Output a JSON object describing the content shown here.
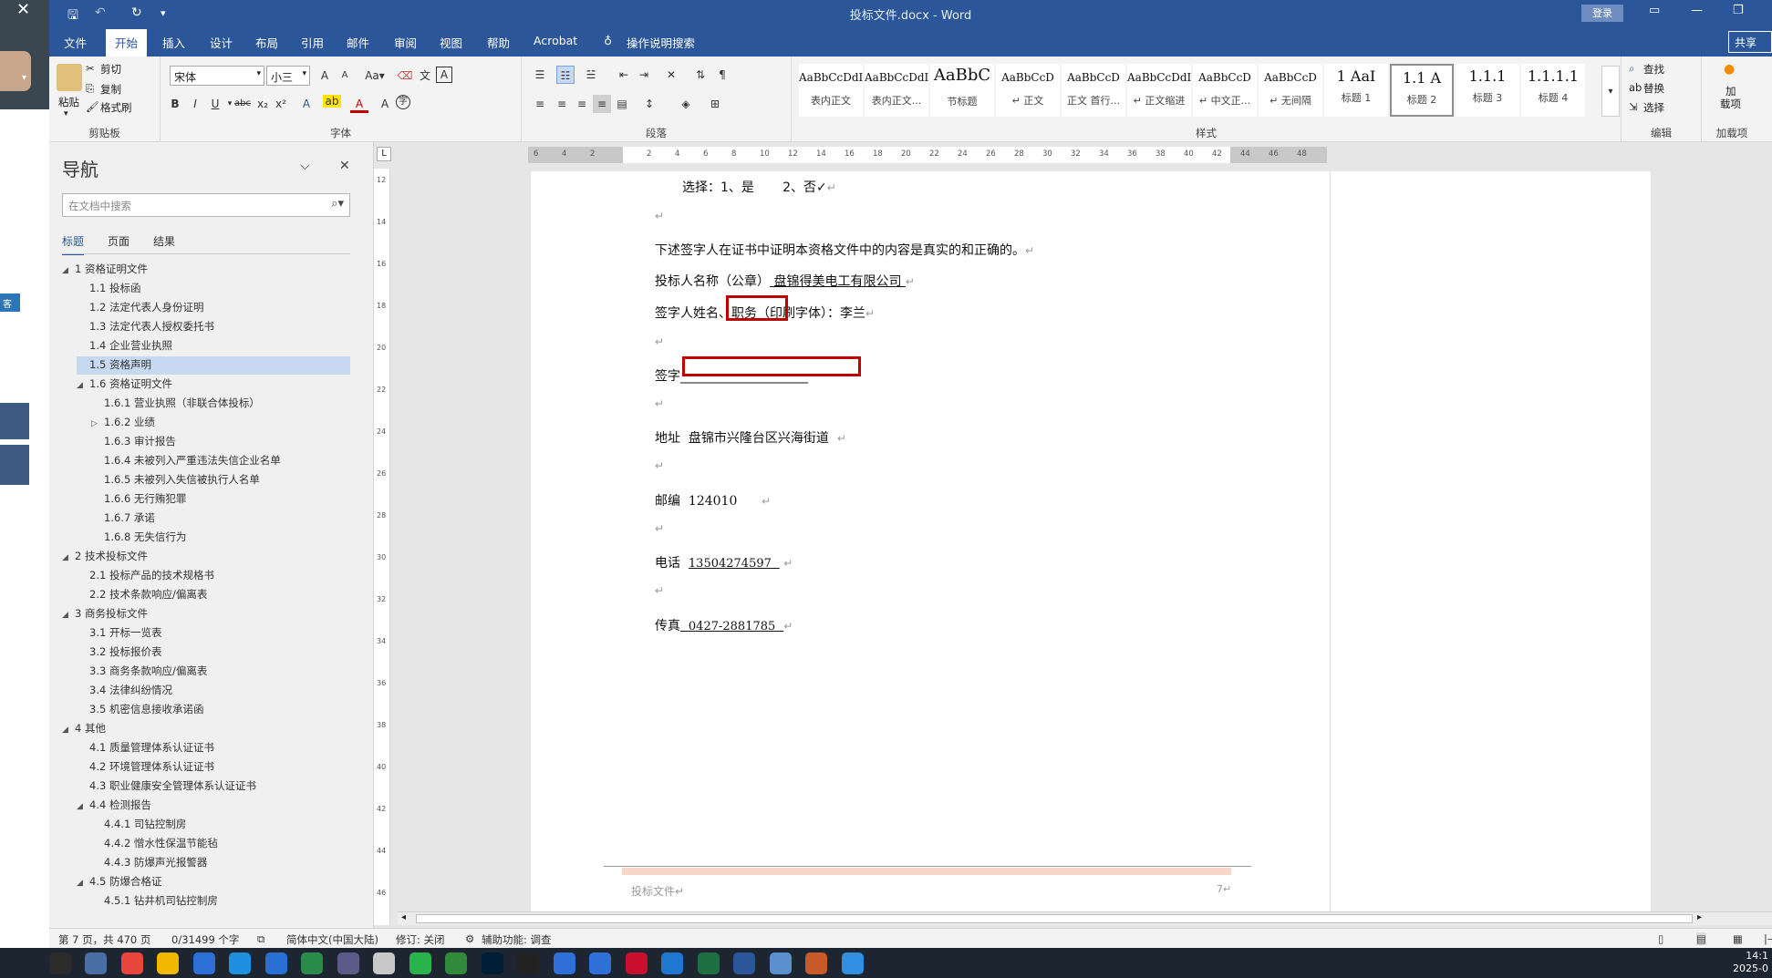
{
  "window": {
    "title": "投标文件.docx  -  Word",
    "login_label": "登录",
    "minimize_glyph": "—",
    "restore_glyph": "❐",
    "layout_glyph": "▭"
  },
  "quick_access": {
    "save_icon": "save-icon",
    "undo_icon": "undo-icon",
    "redo_icon": "redo-icon"
  },
  "tabs": [
    "文件",
    "开始",
    "插入",
    "设计",
    "布局",
    "引用",
    "邮件",
    "审阅",
    "视图",
    "帮助",
    "Acrobat",
    "操作说明搜索"
  ],
  "active_tab": "开始",
  "share_label": "共享",
  "ribbon": {
    "clipboard": {
      "paste": "粘贴",
      "cut": "剪切",
      "copy": "复制",
      "format_painter": "格式刷",
      "label": "剪贴板"
    },
    "font": {
      "name": "宋体",
      "size": "小三",
      "label": "字体",
      "aa": "Aa",
      "grow": "A",
      "shrink": "A"
    },
    "paragraph": {
      "label": "段落"
    },
    "styles": {
      "label": "样式",
      "items": [
        {
          "preview": "AaBbCcDdI",
          "name": "表内正文"
        },
        {
          "preview": "AaBbCcDdI",
          "name": "表内正文..."
        },
        {
          "preview": "AaBbC",
          "name": "节标题"
        },
        {
          "preview": "AaBbCcD",
          "name": "↵ 正文"
        },
        {
          "preview": "AaBbCcD",
          "name": "正文 首行..."
        },
        {
          "preview": "AaBbCcDdI",
          "name": "↵ 正文缩进"
        },
        {
          "preview": "AaBbCcD",
          "name": "↵ 中文正..."
        },
        {
          "preview": "AaBbCcD",
          "name": "↵ 无间隔"
        },
        {
          "preview": "1   AaI",
          "name": "标题 1"
        },
        {
          "preview": "1.1  A",
          "name": "标题 2"
        },
        {
          "preview": "1.1.1",
          "name": "标题 3"
        },
        {
          "preview": "1.1.1.1",
          "name": "标题 4"
        }
      ],
      "selected": "标题 2"
    },
    "editing": {
      "find": "查找",
      "replace": "替换",
      "select": "选择",
      "label": "编辑"
    },
    "addins": {
      "label_line1": "加",
      "label_line2": "载项",
      "group_label": "加载项"
    }
  },
  "nav": {
    "title": "导航",
    "search_placeholder": "在文档中搜索",
    "tabs": [
      "标题",
      "页面",
      "结果"
    ],
    "active_tab": "标题",
    "items": [
      {
        "text": "1 资格证明文件",
        "toggle": "◢"
      },
      {
        "text": "1.1 投标函",
        "toggle": ""
      },
      {
        "text": "1.2 法定代表人身份证明",
        "toggle": ""
      },
      {
        "text": "1.3 法定代表人授权委托书",
        "toggle": ""
      },
      {
        "text": "1.4 企业营业执照",
        "toggle": ""
      },
      {
        "text": "1.5 资格声明",
        "toggle": ""
      },
      {
        "text": "1.6 资格证明文件",
        "toggle": "◢"
      },
      {
        "text": "1.6.1 营业执照（非联合体投标）",
        "toggle": ""
      },
      {
        "text": "1.6.2 业绩",
        "toggle": "▷"
      },
      {
        "text": "1.6.3 审计报告",
        "toggle": ""
      },
      {
        "text": "1.6.4 未被列入严重违法失信企业名单",
        "toggle": ""
      },
      {
        "text": "1.6.5 未被列入失信被执行人名单",
        "toggle": ""
      },
      {
        "text": "1.6.6 无行贿犯罪",
        "toggle": ""
      },
      {
        "text": "1.6.7 承诺",
        "toggle": ""
      },
      {
        "text": "1.6.8 无失信行为",
        "toggle": ""
      },
      {
        "text": "2 技术投标文件",
        "toggle": "◢"
      },
      {
        "text": "2.1 投标产品的技术规格书",
        "toggle": ""
      },
      {
        "text": "2.2 技术条款响应/偏离表",
        "toggle": ""
      },
      {
        "text": "3 商务投标文件",
        "toggle": "◢"
      },
      {
        "text": "3.1 开标一览表",
        "toggle": ""
      },
      {
        "text": "3.2 投标报价表",
        "toggle": ""
      },
      {
        "text": "3.3 商务条款响应/偏离表",
        "toggle": ""
      },
      {
        "text": "3.4 法律纠纷情况",
        "toggle": ""
      },
      {
        "text": "3.5 机密信息接收承诺函",
        "toggle": ""
      },
      {
        "text": "4 其他",
        "toggle": "◢"
      },
      {
        "text": "4.1 质量管理体系认证证书",
        "toggle": ""
      },
      {
        "text": "4.2 环境管理体系认证证书",
        "toggle": ""
      },
      {
        "text": "4.3 职业健康安全管理体系认证证书",
        "toggle": ""
      },
      {
        "text": "4.4 检测报告",
        "toggle": "◢"
      },
      {
        "text": "4.4.1 司钻控制房",
        "toggle": ""
      },
      {
        "text": "4.4.2 憎水性保温节能毡",
        "toggle": ""
      },
      {
        "text": "4.4.3 防爆声光报警器",
        "toggle": ""
      },
      {
        "text": "4.5 防爆合格证",
        "toggle": "◢"
      },
      {
        "text": "4.5.1 钻井机司钻控制房",
        "toggle": ""
      }
    ],
    "selected": "1.5 资格声明"
  },
  "ruler": {
    "h_ticks": [
      "6",
      "4",
      "2",
      "",
      "2",
      "4",
      "6",
      "8",
      "10",
      "12",
      "14",
      "16",
      "18",
      "20",
      "22",
      "24",
      "26",
      "28",
      "30",
      "32",
      "34",
      "36",
      "38",
      "40",
      "42",
      "44",
      "46",
      "48"
    ],
    "v_ticks": [
      "12",
      "14",
      "16",
      "18",
      "20",
      "22",
      "24",
      "26",
      "28",
      "30",
      "32",
      "34",
      "36",
      "38",
      "40",
      "42",
      "44",
      "46"
    ]
  },
  "document": {
    "line_select": {
      "label": "选择：",
      "opt1": "1、是",
      "opt2": "2、否",
      "check": "✓"
    },
    "line_statement": "下述签字人在证书中证明本资格文件中的内容是真实的和正确的。",
    "line_bidder": {
      "label": "投标人名称（公章）",
      "value": "盘锦得美电工有限公司"
    },
    "line_signer": {
      "label1": "签字人姓名",
      "label2": "、职务",
      "label3": "（印刷字体）：",
      "value": "李兰"
    },
    "line_sign": {
      "label": "签字",
      "blank": "____________________"
    },
    "line_address": {
      "label": "地址",
      "value": "盘锦市兴隆台区兴海街道"
    },
    "line_postcode": {
      "label": "邮编",
      "value": "124010"
    },
    "line_phone": {
      "label": "电话",
      "value": "13504274597"
    },
    "line_fax": {
      "label": "传真",
      "value": "0427-2881785"
    },
    "para_mark": "↵",
    "footer_text": "投标文件↵",
    "footer_page": "7↵"
  },
  "status": {
    "page": "第 7 页，共 470 页",
    "words": "0/31499 个字",
    "language": "简体中文(中国大陆)",
    "track": "修订: 关闭",
    "accessibility": "辅助功能: 调查"
  },
  "taskbar": {
    "clock_time": "14:1",
    "clock_date": "2025-0",
    "icons": [
      "start-icon",
      "search-icon",
      "calculator-icon",
      "chrome-icon",
      "files-icon",
      "app-icon",
      "store-icon",
      "app2-icon",
      "app3-icon",
      "app4-icon",
      "bin-icon",
      "wechat-icon",
      "app5-icon",
      "photoshop-icon",
      "qq-icon",
      "app6-icon",
      "app7-icon",
      "acrobat-icon",
      "edge-icon",
      "excel-icon",
      "word-icon",
      "app8-icon",
      "app9-icon",
      "app10-icon"
    ]
  }
}
